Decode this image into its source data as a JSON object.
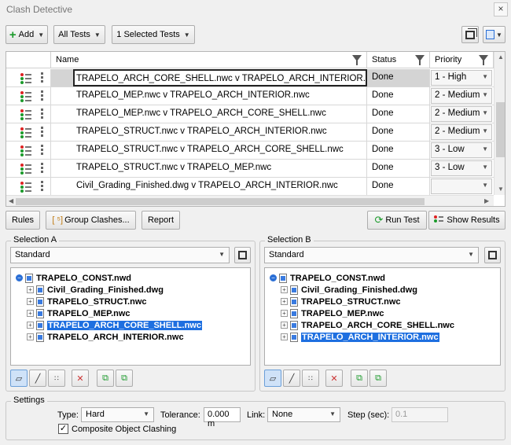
{
  "window": {
    "title": "Clash Detective",
    "close_icon": "×"
  },
  "toolbar": {
    "add_label": "Add",
    "all_tests_label": "All Tests",
    "selected_tests_label": "1 Selected Tests"
  },
  "table": {
    "columns": {
      "name": "Name",
      "status": "Status",
      "priority": "Priority"
    },
    "rows": [
      {
        "name": "TRAPELO_ARCH_CORE_SHELL.nwc v TRAPELO_ARCH_INTERIOR.nwc",
        "status": "Done",
        "priority": "1 - High"
      },
      {
        "name": "TRAPELO_MEP.nwc v TRAPELO_ARCH_INTERIOR.nwc",
        "status": "Done",
        "priority": "2 - Medium"
      },
      {
        "name": "TRAPELO_MEP.nwc v TRAPELO_ARCH_CORE_SHELL.nwc",
        "status": "Done",
        "priority": "2 - Medium"
      },
      {
        "name": "TRAPELO_STRUCT.nwc v TRAPELO_ARCH_INTERIOR.nwc",
        "status": "Done",
        "priority": "2 - Medium"
      },
      {
        "name": "TRAPELO_STRUCT.nwc v TRAPELO_ARCH_CORE_SHELL.nwc",
        "status": "Done",
        "priority": "3 - Low"
      },
      {
        "name": "TRAPELO_STRUCT.nwc v TRAPELO_MEP.nwc",
        "status": "Done",
        "priority": "3 - Low"
      },
      {
        "name": "Civil_Grading_Finished.dwg v TRAPELO_ARCH_INTERIOR.nwc",
        "status": "Done",
        "priority": ""
      }
    ]
  },
  "actions": {
    "rules_label": "Rules",
    "group_clashes_label": "Group Clashes...",
    "report_label": "Report",
    "run_test_label": "Run Test",
    "show_results_label": "Show Results"
  },
  "selection_a": {
    "label": "Selection A",
    "mode": "Standard",
    "root": "TRAPELO_CONST.nwd",
    "children": [
      "Civil_Grading_Finished.dwg",
      "TRAPELO_STRUCT.nwc",
      "TRAPELO_MEP.nwc",
      "TRAPELO_ARCH_CORE_SHELL.nwc",
      "TRAPELO_ARCH_INTERIOR.nwc"
    ]
  },
  "selection_b": {
    "label": "Selection B",
    "mode": "Standard",
    "root": "TRAPELO_CONST.nwd",
    "children": [
      "Civil_Grading_Finished.dwg",
      "TRAPELO_STRUCT.nwc",
      "TRAPELO_MEP.nwc",
      "TRAPELO_ARCH_CORE_SHELL.nwc",
      "TRAPELO_ARCH_INTERIOR.nwc"
    ]
  },
  "settings": {
    "label": "Settings",
    "type_label": "Type:",
    "type_value": "Hard",
    "tolerance_label": "Tolerance:",
    "tolerance_value": "0.000 m",
    "link_label": "Link:",
    "link_value": "None",
    "step_label": "Step (sec):",
    "step_value": "0.1",
    "composite_label": "Composite Object Clashing",
    "composite_checked": "✓"
  },
  "colors": {
    "accent": "#1e6fe0",
    "add_green": "#1a9a2a"
  }
}
